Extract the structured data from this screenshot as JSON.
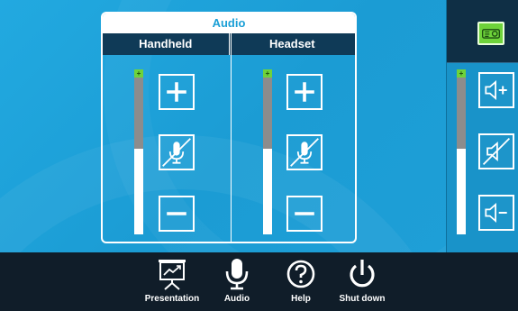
{
  "audio": {
    "title": "Audio",
    "channels": [
      {
        "name": "Handheld",
        "level": 0.52
      },
      {
        "name": "Headset",
        "level": 0.52
      }
    ]
  },
  "room_volume": {
    "level": 0.52
  },
  "meter_cap": "+",
  "colors": {
    "accent": "#1a9fd6",
    "header": "#0f3a57",
    "nav_bg": "#101d29",
    "active_green": "#6ed33a"
  },
  "nav": [
    {
      "label": "Presentation",
      "icon": "presentation-icon"
    },
    {
      "label": "Audio",
      "icon": "microphone-icon"
    },
    {
      "label": "Help",
      "icon": "help-icon"
    },
    {
      "label": "Shut down",
      "icon": "power-icon"
    }
  ]
}
